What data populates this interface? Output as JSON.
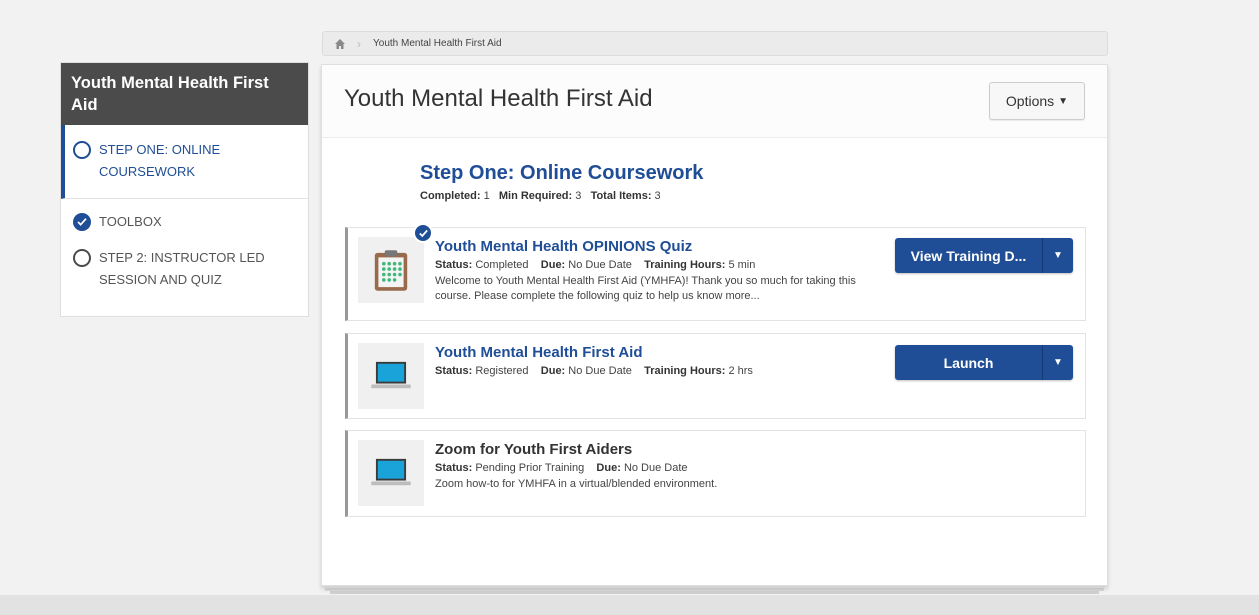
{
  "breadcrumb": {
    "home_icon": "home-icon",
    "current": "Youth Mental Health First Aid"
  },
  "sidebar": {
    "title": "Youth Mental Health First Aid",
    "items": [
      {
        "label": "STEP ONE: ONLINE COURSEWORK",
        "state": "incomplete",
        "icon": "circle-outline-icon"
      },
      {
        "label": "TOOLBOX",
        "state": "complete",
        "icon": "check-circle-icon"
      },
      {
        "label": "STEP 2: INSTRUCTOR LED SESSION AND QUIZ",
        "state": "incomplete",
        "icon": "circle-outline-icon"
      }
    ]
  },
  "main": {
    "title": "Youth Mental Health First Aid",
    "options_label": "Options",
    "section": {
      "title": "Step One: Online Coursework",
      "completed_label": "Completed:",
      "completed_value": "1",
      "min_required_label": "Min Required:",
      "min_required_value": "3",
      "total_items_label": "Total Items:",
      "total_items_value": "3"
    },
    "items": [
      {
        "title": "Youth Mental Health OPINIONS Quiz",
        "status_label": "Status:",
        "status": "Completed",
        "due_label": "Due:",
        "due": "No Due Date",
        "hours_label": "Training Hours:",
        "hours": "5 min",
        "description": "Welcome to Youth Mental Health First Aid (YMHFA)! Thank you so much for taking this course. Please complete the following quiz to help us know more...",
        "button_label": "View Training D...",
        "icon": "clipboard-icon"
      },
      {
        "title": "Youth Mental Health First Aid",
        "status_label": "Status:",
        "status": "Registered",
        "due_label": "Due:",
        "due": "No Due Date",
        "hours_label": "Training Hours:",
        "hours": "2 hrs",
        "button_label": "Launch",
        "icon": "laptop-icon"
      },
      {
        "title": "Zoom for Youth First Aiders",
        "status_label": "Status:",
        "status": "Pending Prior Training",
        "due_label": "Due:",
        "due": "No Due Date",
        "description": "Zoom how-to for YMHFA in a virtual/blended environment.",
        "icon": "laptop-icon"
      }
    ]
  },
  "colors": {
    "accent": "#1f4e96",
    "sidebar_header": "#4b4b4b",
    "background": "#f2f2f2"
  }
}
